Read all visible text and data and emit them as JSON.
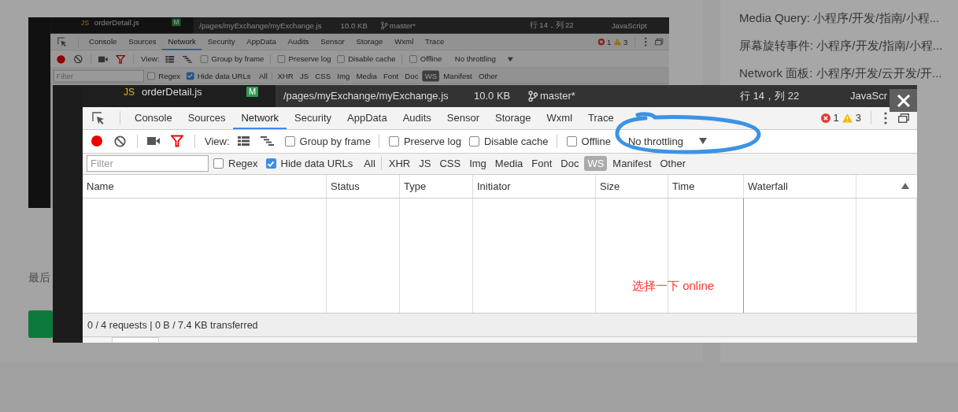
{
  "article": {
    "screenshot": {
      "title_bar": {
        "file_icon": "JS",
        "file_name": "orderDetail.js",
        "badge": "M",
        "path": "/pages/myExchange/myExchange.js",
        "size": "10.0 KB",
        "branch": "master*",
        "cursor": "行 14，列 22",
        "language": "JavaScript"
      },
      "tabs": [
        {
          "label": "Console",
          "selected": false
        },
        {
          "label": "Sources",
          "selected": false
        },
        {
          "label": "Network",
          "selected": true
        },
        {
          "label": "Security",
          "selected": false
        },
        {
          "label": "AppData",
          "selected": false
        },
        {
          "label": "Audits",
          "selected": false
        },
        {
          "label": "Sensor",
          "selected": false
        },
        {
          "label": "Storage",
          "selected": false
        },
        {
          "label": "Wxml",
          "selected": false
        },
        {
          "label": "Trace",
          "selected": false
        }
      ],
      "errors": "1",
      "warnings": "3",
      "toolbar": {
        "recording": true,
        "filter_on": true,
        "view_label": "View:",
        "options": [
          {
            "label": "Group by frame",
            "checked": false
          },
          {
            "label": "Preserve log",
            "checked": false
          },
          {
            "label": "Disable cache",
            "checked": false
          },
          {
            "label": "Offline",
            "checked": false
          }
        ],
        "throttling": "No throttling"
      },
      "filter_bar": {
        "placeholder": "Filter",
        "options": [
          {
            "label": "Regex",
            "checked": false
          },
          {
            "label": "Hide data URLs",
            "checked": true
          }
        ],
        "types": [
          {
            "label": "All",
            "selected": false
          },
          {
            "label": "XHR",
            "selected": false
          },
          {
            "label": "JS",
            "selected": false
          },
          {
            "label": "CSS",
            "selected": false
          },
          {
            "label": "Img",
            "selected": false
          },
          {
            "label": "Media",
            "selected": false
          },
          {
            "label": "Font",
            "selected": false
          },
          {
            "label": "Doc",
            "selected": false
          },
          {
            "label": "WS",
            "selected": true
          },
          {
            "label": "Manifest",
            "selected": false
          },
          {
            "label": "Other",
            "selected": false
          }
        ]
      }
    },
    "text": "最后"
  },
  "sidebar": {
    "links": [
      "Media Query: 小程序/开发/指南/小程...",
      "屏幕旋转事件: 小程序/开发/指南/小程...",
      "Network 面板: 小程序/开发/云开发/开..."
    ]
  },
  "lightbox": {
    "screenshot": {
      "title_bar": {
        "file_icon": "JS",
        "file_name": "orderDetail.js",
        "badge": "M",
        "path": "/pages/myExchange/myExchange.js",
        "size": "10.0 KB",
        "branch": "master*",
        "cursor": "行 14，列 22",
        "language": "JavaScr"
      },
      "tabs": [
        {
          "label": "Console",
          "selected": false
        },
        {
          "label": "Sources",
          "selected": false
        },
        {
          "label": "Network",
          "selected": true
        },
        {
          "label": "Security",
          "selected": false
        },
        {
          "label": "AppData",
          "selected": false
        },
        {
          "label": "Audits",
          "selected": false
        },
        {
          "label": "Sensor",
          "selected": false
        },
        {
          "label": "Storage",
          "selected": false
        },
        {
          "label": "Wxml",
          "selected": false
        },
        {
          "label": "Trace",
          "selected": false
        }
      ],
      "errors": "1",
      "warnings": "3",
      "toolbar": {
        "recording": true,
        "filter_on": true,
        "view_label": "View:",
        "options": [
          {
            "label": "Group by frame",
            "checked": false
          },
          {
            "label": "Preserve log",
            "checked": false
          },
          {
            "label": "Disable cache",
            "checked": false
          },
          {
            "label": "Offline",
            "checked": false
          }
        ],
        "throttling": "No throttling"
      },
      "filter_bar": {
        "placeholder": "Filter",
        "options": [
          {
            "label": "Regex",
            "checked": false
          },
          {
            "label": "Hide data URLs",
            "checked": true
          }
        ],
        "types": [
          {
            "label": "All",
            "selected": false
          },
          {
            "label": "XHR",
            "selected": false
          },
          {
            "label": "JS",
            "selected": false
          },
          {
            "label": "CSS",
            "selected": false
          },
          {
            "label": "Img",
            "selected": false
          },
          {
            "label": "Media",
            "selected": false
          },
          {
            "label": "Font",
            "selected": false
          },
          {
            "label": "Doc",
            "selected": false
          },
          {
            "label": "WS",
            "selected": true
          },
          {
            "label": "Manifest",
            "selected": false
          },
          {
            "label": "Other",
            "selected": false
          }
        ]
      },
      "table": {
        "columns": [
          {
            "label": "Name",
            "sorted": false
          },
          {
            "label": "Status",
            "sorted": false
          },
          {
            "label": "Type",
            "sorted": false
          },
          {
            "label": "Initiator",
            "sorted": false
          },
          {
            "label": "Size",
            "sorted": false
          },
          {
            "label": "Time",
            "sorted": false
          },
          {
            "label": "Waterfall",
            "sorted": false
          },
          {
            "sorted": true
          }
        ]
      },
      "status_bar": "0 / 4 requests | 0 B / 7.4 KB transferred"
    },
    "annotation": "选择一下 online"
  }
}
